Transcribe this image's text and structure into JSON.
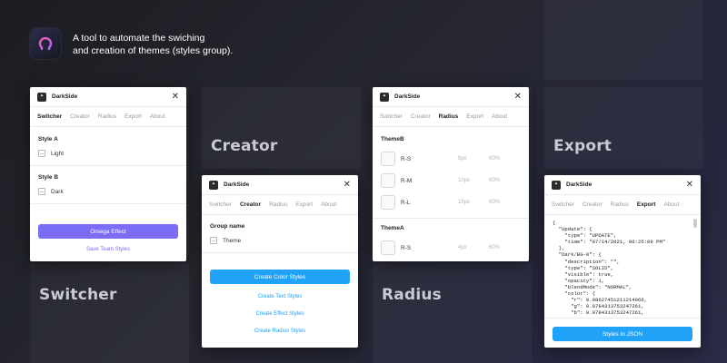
{
  "header": {
    "tagline_line1": "A tool to automate the swiching",
    "tagline_line2": "and creation of themes (styles group)."
  },
  "background_labels": {
    "creator": "Creator",
    "export": "Export",
    "switcher": "Switcher",
    "radius": "Radius"
  },
  "app_title": "DarkSide",
  "tabs": [
    "Switcher",
    "Creator",
    "Radius",
    "Export",
    "About"
  ],
  "switcher": {
    "style_a_label": "Style A",
    "style_a_value": "Light",
    "style_b_label": "Style B",
    "style_b_value": "Dark",
    "primary_button": "Omega Effect",
    "secondary_link": "Save Team Styles"
  },
  "creator": {
    "group_label": "Group name",
    "group_value": "Theme",
    "create_color": "Create Color Styles",
    "create_text": "Create Text Styles",
    "create_effect": "Create Effect Styles",
    "create_radius": "Create Radius Styles"
  },
  "radius": {
    "groups": [
      {
        "name": "ThemeB",
        "rows": [
          {
            "name": "R-S",
            "value": "5px",
            "percent": "60%"
          },
          {
            "name": "R-M",
            "value": "10px",
            "percent": "60%"
          },
          {
            "name": "R-L",
            "value": "15px",
            "percent": "60%"
          }
        ]
      },
      {
        "name": "ThemeA",
        "rows": [
          {
            "name": "R-S",
            "value": "4px",
            "percent": "60%"
          }
        ]
      }
    ]
  },
  "export": {
    "json_text": "{\n  \"Update\": {\n    \"type\": \"UPDATE\",\n    \"time\": \"07/14/2021, 00:25:09 PM\"\n  },\n  \"Dark/BG-0\": {\n    \"description\": \"\",\n    \"type\": \"SOLID\",\n    \"visible\": true,\n    \"opacity\": 1,\n    \"blendMode\": \"NORMAL\",\n    \"color\": {\n      \"r\": 0.08627451211214066,\n      \"g\": 0.0784313753247261,\n      \"b\": 0.0784313753247261,",
    "button": "Styles to JSON"
  },
  "colors": {
    "accent_purple": "#7b6cf6",
    "accent_blue": "#1fa2f7"
  }
}
